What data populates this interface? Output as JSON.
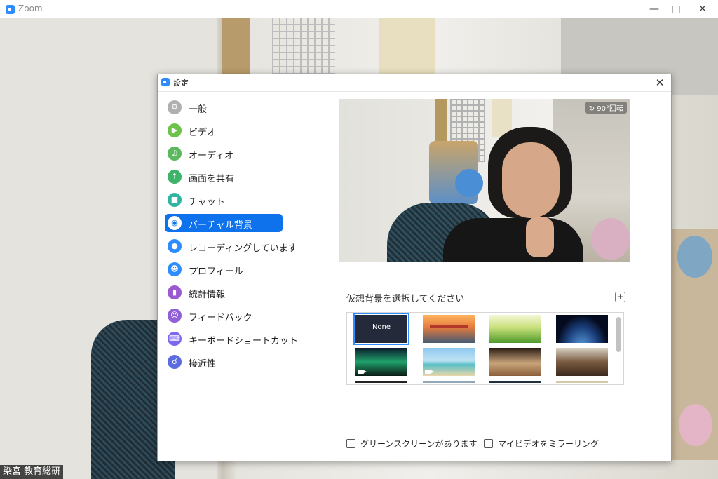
{
  "window": {
    "title": "Zoom"
  },
  "participant": {
    "name": "染宮 教育総研"
  },
  "dialog": {
    "title": "設定"
  },
  "sidebar": {
    "items": [
      {
        "label": "一般",
        "icon": "gear-icon",
        "color": "#b0b0b0",
        "active": false
      },
      {
        "label": "ビデオ",
        "icon": "video-icon",
        "color": "#6cc24a",
        "active": false
      },
      {
        "label": "オーディオ",
        "icon": "headphones-icon",
        "color": "#5cb85c",
        "active": false
      },
      {
        "label": "画面を共有",
        "icon": "share-screen-icon",
        "color": "#3fb36a",
        "active": false
      },
      {
        "label": "チャット",
        "icon": "chat-icon",
        "color": "#2fb5a1",
        "active": false
      },
      {
        "label": "バーチャル背景",
        "icon": "portrait-icon",
        "color": "#0e72ed",
        "active": true
      },
      {
        "label": "レコーディングしています",
        "icon": "record-icon",
        "color": "#2d8cff",
        "active": false
      },
      {
        "label": "プロフィール",
        "icon": "profile-icon",
        "color": "#2d8cff",
        "active": false
      },
      {
        "label": "統計情報",
        "icon": "stats-icon",
        "color": "#9b59d0",
        "active": false
      },
      {
        "label": "フィードバック",
        "icon": "feedback-icon",
        "color": "#8e5fd6",
        "active": false
      },
      {
        "label": "キーボードショートカット",
        "icon": "keyboard-icon",
        "color": "#7b68ee",
        "active": false
      },
      {
        "label": "接近性",
        "icon": "accessibility-icon",
        "color": "#5b6be0",
        "active": false
      }
    ]
  },
  "preview": {
    "rotate_label": "90°回転"
  },
  "backgrounds": {
    "label": "仮想背景を選択してください",
    "add_icon": "+",
    "items": [
      {
        "label": "None",
        "selected": true
      },
      {
        "label": "",
        "selected": false
      },
      {
        "label": "",
        "selected": false
      },
      {
        "label": "",
        "selected": false
      },
      {
        "label": "",
        "selected": false
      },
      {
        "label": "",
        "selected": false
      },
      {
        "label": "",
        "selected": false
      },
      {
        "label": "",
        "selected": false
      }
    ]
  },
  "options": {
    "green_screen": "グリーンスクリーンがあります",
    "mirror_video": "マイビデオをミラーリング"
  },
  "colors": {
    "accent": "#0e72ed",
    "brand": "#2d8cff"
  }
}
